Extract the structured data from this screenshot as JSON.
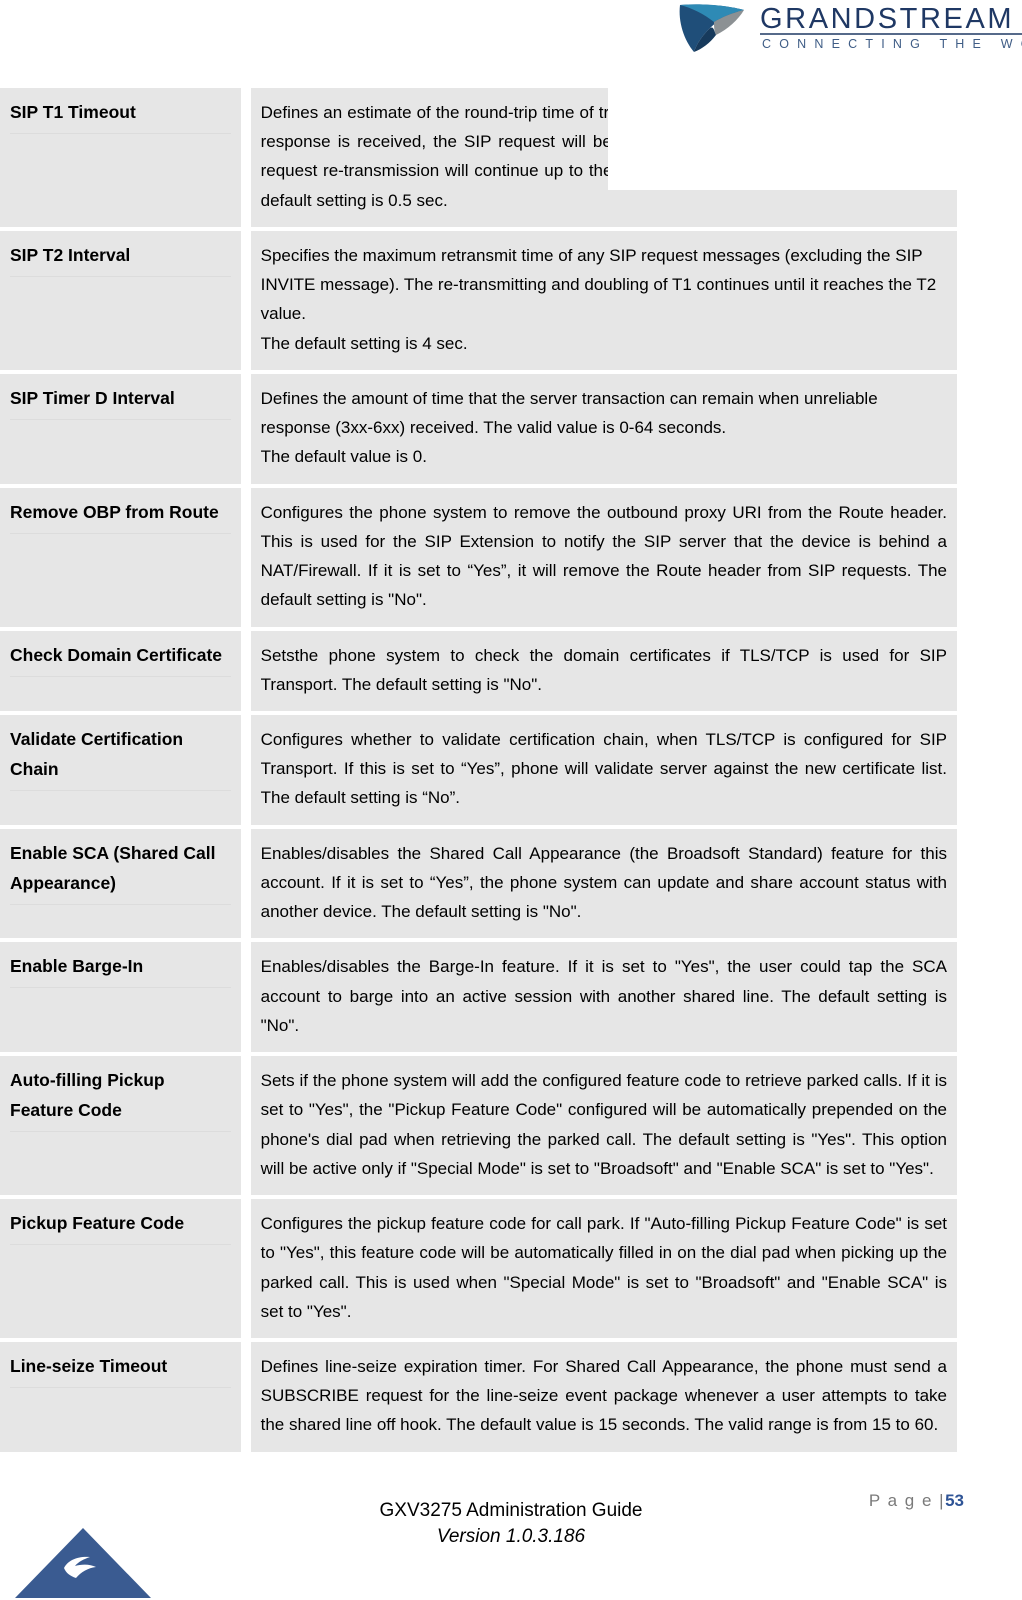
{
  "document": {
    "guide_title": "GXV3275 Administration Guide",
    "version": "Version 1.0.3.186",
    "page_label": "P a g e  |",
    "page_number": "53"
  },
  "brand": {
    "logo_wordmark": "GRANDSTREAM",
    "logo_tagline": "CONNECTING THE WORLD",
    "colors": {
      "wordmark_navy": "#1f3864",
      "swoosh_teal": "#2e8ab5",
      "swoosh_navy": "#1f4e79",
      "swoosh_gray": "#8c9194",
      "footer_triangle_blue": "#3a5b91",
      "page_number_blue": "#2f5496",
      "table_cell_bg": "#e6e6e6"
    }
  },
  "spec_table": {
    "rows": [
      {
        "label": "SIP T1 Timeout",
        "paragraphs": [
          "Defines an estimate of the round-trip time of transactions between a client and server. If no response is received, the SIP request will be re-transmitted in 2*T1 and then 4*T1. The request re-transmission will continue up to the maximum amount of time define by T2.The default setting is 0.5 sec."
        ]
      },
      {
        "label": "SIP T2 Interval",
        "paragraphs": [
          "Specifies the maximum retransmit time of any SIP request messages (excluding the SIP INVITE message). The re-transmitting and doubling of T1 continues until it reaches the T2 value.",
          "The default setting is 4 sec."
        ]
      },
      {
        "label": "SIP Timer D Interval",
        "paragraphs": [
          "Defines the amount of time that the server transaction can remain when unreliable response (3xx-6xx) received. The valid value is 0-64 seconds.",
          "The default value is 0."
        ]
      },
      {
        "label": "Remove OBP from Route",
        "paragraphs": [
          "Configures the phone system to remove the outbound proxy URI from the Route header. This is used for the SIP Extension to notify the SIP server that the device is behind a NAT/Firewall. If it is set to “Yes”, it will remove the Route header from SIP requests. The default setting is \"No\"."
        ]
      },
      {
        "label": "Check Domain Certificate",
        "paragraphs": [
          "Setsthe phone system to check the domain certificates if TLS/TCP is used for SIP Transport. The default setting is \"No\"."
        ]
      },
      {
        "label": "Validate Certification Chain",
        "paragraphs": [
          "Configures whether to validate certification chain, when TLS/TCP is configured for SIP Transport. If this is set to “Yes”, phone will validate server against the new certificate list. The default setting is “No”."
        ]
      },
      {
        "label": "Enable SCA (Shared Call Appearance)",
        "paragraphs": [
          "Enables/disables the Shared Call Appearance (the Broadsoft Standard) feature for this account. If it is set to “Yes”, the phone system can update and share account status with another device. The default setting is \"No\"."
        ]
      },
      {
        "label": "Enable Barge-In",
        "paragraphs": [
          "Enables/disables the Barge-In feature. If it is set to \"Yes\", the user could tap the SCA account to barge into an active session with another shared line. The default setting is \"No\"."
        ]
      },
      {
        "label": "Auto-filling Pickup Feature Code",
        "paragraphs": [
          "Sets if the phone system will add the configured feature code to retrieve parked calls. If it is set to \"Yes\", the \"Pickup Feature Code\" configured will be automatically prepended on the phone's dial pad when retrieving the parked call. The default setting is \"Yes\". This option will be active only if \"Special Mode\" is set to \"Broadsoft\" and \"Enable SCA\" is set to \"Yes\"."
        ]
      },
      {
        "label": "Pickup Feature Code",
        "paragraphs": [
          "Configures the pickup feature code for call park. If \"Auto-filling Pickup Feature Code\" is set to \"Yes\", this feature code will be automatically filled in on the dial pad when picking up the parked call. This is used when \"Special Mode\" is set to \"Broadsoft\" and \"Enable SCA\" is set to \"Yes\"."
        ]
      },
      {
        "label": "Line-seize Timeout",
        "paragraphs": [
          "Defines line-seize expiration timer. For Shared Call Appearance, the phone must send a SUBSCRIBE request for the line-seize event package whenever a user attempts to take the shared line off hook. The default value is 15 seconds. The valid range is from 15 to 60."
        ]
      }
    ]
  }
}
